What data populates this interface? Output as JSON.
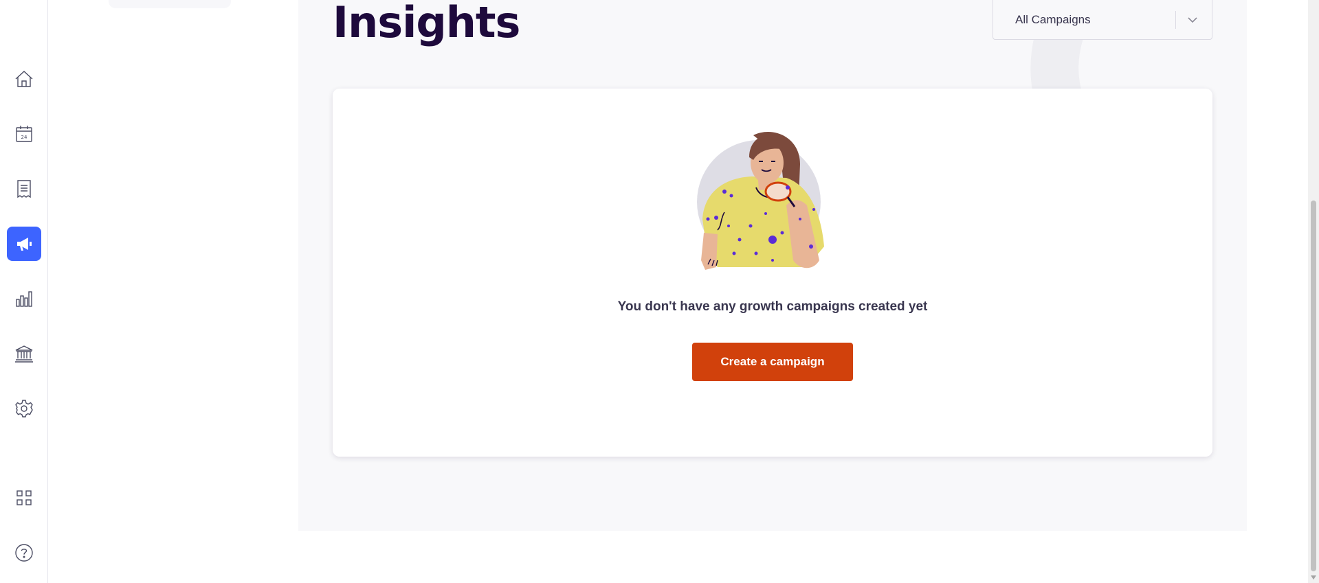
{
  "rail": {
    "items": [
      {
        "name": "home-icon",
        "active": false
      },
      {
        "name": "calendar-icon",
        "active": false,
        "text": "24"
      },
      {
        "name": "receipt-icon",
        "active": false
      },
      {
        "name": "megaphone-icon",
        "active": true
      },
      {
        "name": "bar-chart-icon",
        "active": false
      },
      {
        "name": "bank-icon",
        "active": false
      },
      {
        "name": "gear-icon",
        "active": false
      },
      {
        "name": "apps-grid-icon",
        "active": false
      },
      {
        "name": "help-icon",
        "active": false
      }
    ]
  },
  "page": {
    "title": "Insights"
  },
  "filter": {
    "selected": "All Campaigns"
  },
  "empty_state": {
    "message": "You don't have any growth campaigns created yet",
    "button_label": "Create a campaign"
  },
  "colors": {
    "accent_active": "#3d64ff",
    "cta": "#d1410c",
    "title": "#1e0a3c",
    "text": "#39364f",
    "main_bg": "#f8f8fa"
  }
}
